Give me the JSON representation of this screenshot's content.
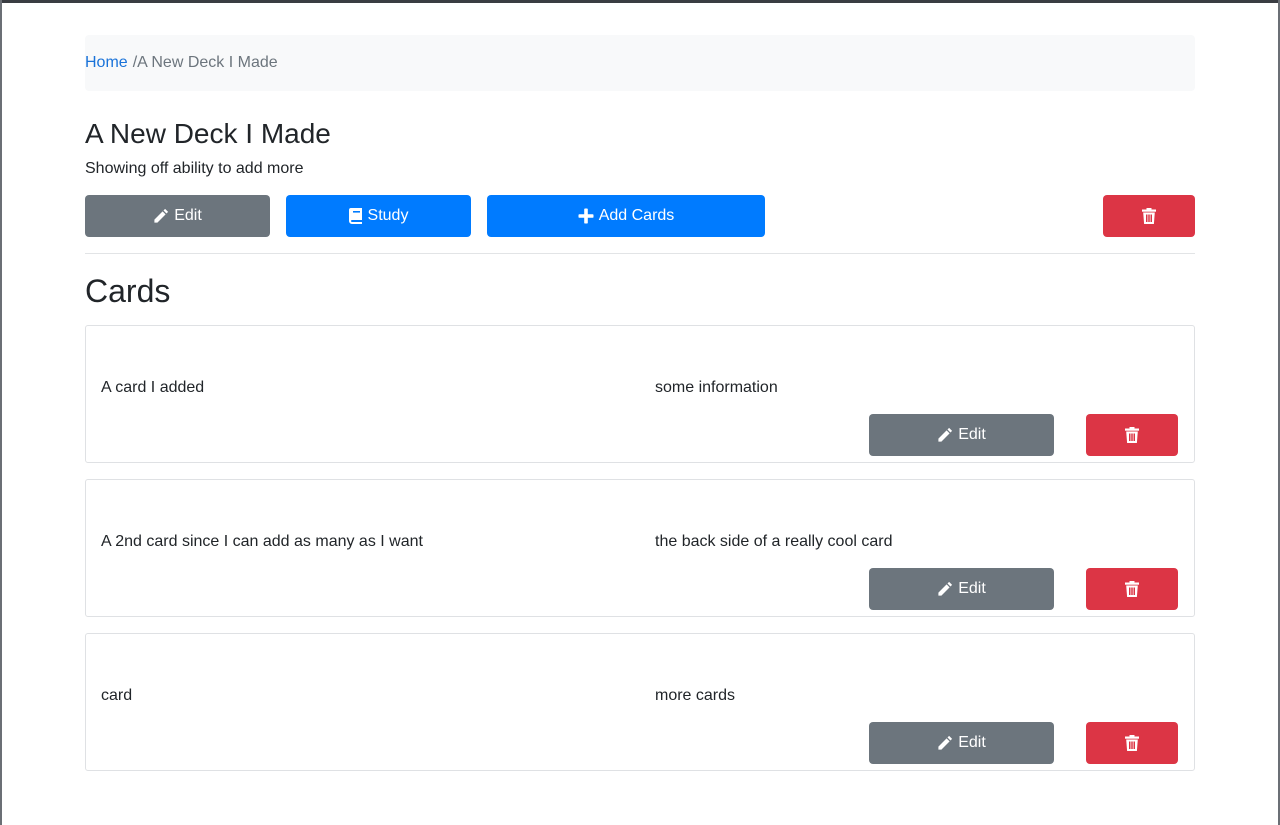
{
  "breadcrumb": {
    "home_label": "Home",
    "separator": "/",
    "current_label": "A New Deck I Made"
  },
  "deck": {
    "title": "A New Deck I Made",
    "description": "Showing off ability to add more"
  },
  "toolbar": {
    "edit_label": "Edit",
    "study_label": "Study",
    "add_cards_label": "Add Cards"
  },
  "cards_section": {
    "heading": "Cards",
    "cards": [
      {
        "front": "A card I added",
        "back": "some information",
        "edit_label": "Edit"
      },
      {
        "front": "A 2nd card since I can add as many as I want",
        "back": "the back side of a really cool card",
        "edit_label": "Edit"
      },
      {
        "front": "card",
        "back": "more cards",
        "edit_label": "Edit"
      }
    ]
  },
  "icons": {
    "edit": "pencil-icon",
    "study": "book-icon",
    "add": "plus-icon",
    "delete": "trash-icon"
  },
  "colors": {
    "primary": "#007bff",
    "secondary": "#6c757d",
    "danger": "#dc3545",
    "link": "#1a73d9"
  }
}
